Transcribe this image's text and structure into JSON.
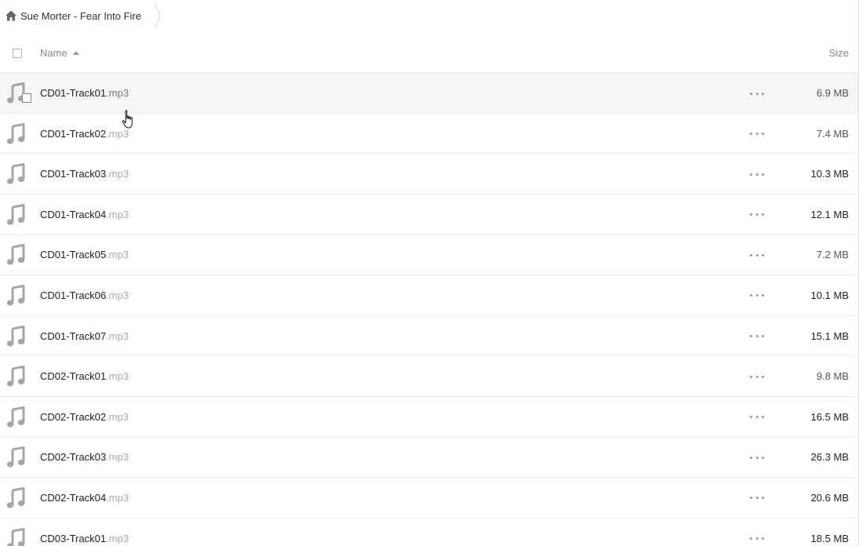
{
  "breadcrumb": {
    "home_icon": "home-icon",
    "folder": "Sue Morter - Fear Into Fire"
  },
  "header": {
    "name_label": "Name",
    "size_label": "Size",
    "sort": "ascending"
  },
  "files": [
    {
      "name": "CD01-Track01",
      "ext": ".mp3",
      "size": "6.9 MB",
      "icon": "music-note-icon"
    },
    {
      "name": "CD01-Track02",
      "ext": ".mp3",
      "size": "7.4 MB",
      "icon": "music-note-icon"
    },
    {
      "name": "CD01-Track03",
      "ext": ".mp3",
      "size": "10.3 MB",
      "icon": "music-note-icon"
    },
    {
      "name": "CD01-Track04",
      "ext": ".mp3",
      "size": "12.1 MB",
      "icon": "music-note-icon"
    },
    {
      "name": "CD01-Track05",
      "ext": ".mp3",
      "size": "7.2 MB",
      "icon": "music-note-icon"
    },
    {
      "name": "CD01-Track06",
      "ext": ".mp3",
      "size": "10.1 MB",
      "icon": "music-note-icon"
    },
    {
      "name": "CD01-Track07",
      "ext": ".mp3",
      "size": "15.1 MB",
      "icon": "music-note-icon"
    },
    {
      "name": "CD02-Track01",
      "ext": ".mp3",
      "size": "9.8 MB",
      "icon": "music-note-icon"
    },
    {
      "name": "CD02-Track02",
      "ext": ".mp3",
      "size": "16.5 MB",
      "icon": "music-note-icon"
    },
    {
      "name": "CD02-Track03",
      "ext": ".mp3",
      "size": "26.3 MB",
      "icon": "music-note-icon"
    },
    {
      "name": "CD02-Track04",
      "ext": ".mp3",
      "size": "20.6 MB",
      "icon": "music-note-icon"
    },
    {
      "name": "CD03-Track01",
      "ext": ".mp3",
      "size": "18.5 MB",
      "icon": "music-note-icon"
    }
  ],
  "colors": {
    "icon_gray": "#a6a6a6",
    "hover_row": "#f5f5f5",
    "extension_gray": "#aaaaaa"
  }
}
